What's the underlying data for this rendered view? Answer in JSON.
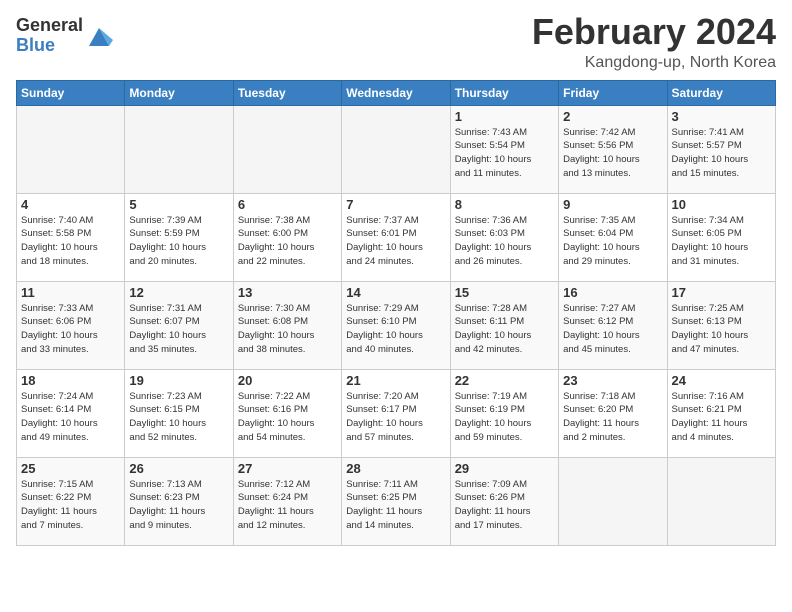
{
  "logo": {
    "general": "General",
    "blue": "Blue"
  },
  "header": {
    "title": "February 2024",
    "subtitle": "Kangdong-up, North Korea"
  },
  "weekdays": [
    "Sunday",
    "Monday",
    "Tuesday",
    "Wednesday",
    "Thursday",
    "Friday",
    "Saturday"
  ],
  "weeks": [
    [
      {
        "day": "",
        "info": ""
      },
      {
        "day": "",
        "info": ""
      },
      {
        "day": "",
        "info": ""
      },
      {
        "day": "",
        "info": ""
      },
      {
        "day": "1",
        "info": "Sunrise: 7:43 AM\nSunset: 5:54 PM\nDaylight: 10 hours\nand 11 minutes."
      },
      {
        "day": "2",
        "info": "Sunrise: 7:42 AM\nSunset: 5:56 PM\nDaylight: 10 hours\nand 13 minutes."
      },
      {
        "day": "3",
        "info": "Sunrise: 7:41 AM\nSunset: 5:57 PM\nDaylight: 10 hours\nand 15 minutes."
      }
    ],
    [
      {
        "day": "4",
        "info": "Sunrise: 7:40 AM\nSunset: 5:58 PM\nDaylight: 10 hours\nand 18 minutes."
      },
      {
        "day": "5",
        "info": "Sunrise: 7:39 AM\nSunset: 5:59 PM\nDaylight: 10 hours\nand 20 minutes."
      },
      {
        "day": "6",
        "info": "Sunrise: 7:38 AM\nSunset: 6:00 PM\nDaylight: 10 hours\nand 22 minutes."
      },
      {
        "day": "7",
        "info": "Sunrise: 7:37 AM\nSunset: 6:01 PM\nDaylight: 10 hours\nand 24 minutes."
      },
      {
        "day": "8",
        "info": "Sunrise: 7:36 AM\nSunset: 6:03 PM\nDaylight: 10 hours\nand 26 minutes."
      },
      {
        "day": "9",
        "info": "Sunrise: 7:35 AM\nSunset: 6:04 PM\nDaylight: 10 hours\nand 29 minutes."
      },
      {
        "day": "10",
        "info": "Sunrise: 7:34 AM\nSunset: 6:05 PM\nDaylight: 10 hours\nand 31 minutes."
      }
    ],
    [
      {
        "day": "11",
        "info": "Sunrise: 7:33 AM\nSunset: 6:06 PM\nDaylight: 10 hours\nand 33 minutes."
      },
      {
        "day": "12",
        "info": "Sunrise: 7:31 AM\nSunset: 6:07 PM\nDaylight: 10 hours\nand 35 minutes."
      },
      {
        "day": "13",
        "info": "Sunrise: 7:30 AM\nSunset: 6:08 PM\nDaylight: 10 hours\nand 38 minutes."
      },
      {
        "day": "14",
        "info": "Sunrise: 7:29 AM\nSunset: 6:10 PM\nDaylight: 10 hours\nand 40 minutes."
      },
      {
        "day": "15",
        "info": "Sunrise: 7:28 AM\nSunset: 6:11 PM\nDaylight: 10 hours\nand 42 minutes."
      },
      {
        "day": "16",
        "info": "Sunrise: 7:27 AM\nSunset: 6:12 PM\nDaylight: 10 hours\nand 45 minutes."
      },
      {
        "day": "17",
        "info": "Sunrise: 7:25 AM\nSunset: 6:13 PM\nDaylight: 10 hours\nand 47 minutes."
      }
    ],
    [
      {
        "day": "18",
        "info": "Sunrise: 7:24 AM\nSunset: 6:14 PM\nDaylight: 10 hours\nand 49 minutes."
      },
      {
        "day": "19",
        "info": "Sunrise: 7:23 AM\nSunset: 6:15 PM\nDaylight: 10 hours\nand 52 minutes."
      },
      {
        "day": "20",
        "info": "Sunrise: 7:22 AM\nSunset: 6:16 PM\nDaylight: 10 hours\nand 54 minutes."
      },
      {
        "day": "21",
        "info": "Sunrise: 7:20 AM\nSunset: 6:17 PM\nDaylight: 10 hours\nand 57 minutes."
      },
      {
        "day": "22",
        "info": "Sunrise: 7:19 AM\nSunset: 6:19 PM\nDaylight: 10 hours\nand 59 minutes."
      },
      {
        "day": "23",
        "info": "Sunrise: 7:18 AM\nSunset: 6:20 PM\nDaylight: 11 hours\nand 2 minutes."
      },
      {
        "day": "24",
        "info": "Sunrise: 7:16 AM\nSunset: 6:21 PM\nDaylight: 11 hours\nand 4 minutes."
      }
    ],
    [
      {
        "day": "25",
        "info": "Sunrise: 7:15 AM\nSunset: 6:22 PM\nDaylight: 11 hours\nand 7 minutes."
      },
      {
        "day": "26",
        "info": "Sunrise: 7:13 AM\nSunset: 6:23 PM\nDaylight: 11 hours\nand 9 minutes."
      },
      {
        "day": "27",
        "info": "Sunrise: 7:12 AM\nSunset: 6:24 PM\nDaylight: 11 hours\nand 12 minutes."
      },
      {
        "day": "28",
        "info": "Sunrise: 7:11 AM\nSunset: 6:25 PM\nDaylight: 11 hours\nand 14 minutes."
      },
      {
        "day": "29",
        "info": "Sunrise: 7:09 AM\nSunset: 6:26 PM\nDaylight: 11 hours\nand 17 minutes."
      },
      {
        "day": "",
        "info": ""
      },
      {
        "day": "",
        "info": ""
      }
    ]
  ]
}
